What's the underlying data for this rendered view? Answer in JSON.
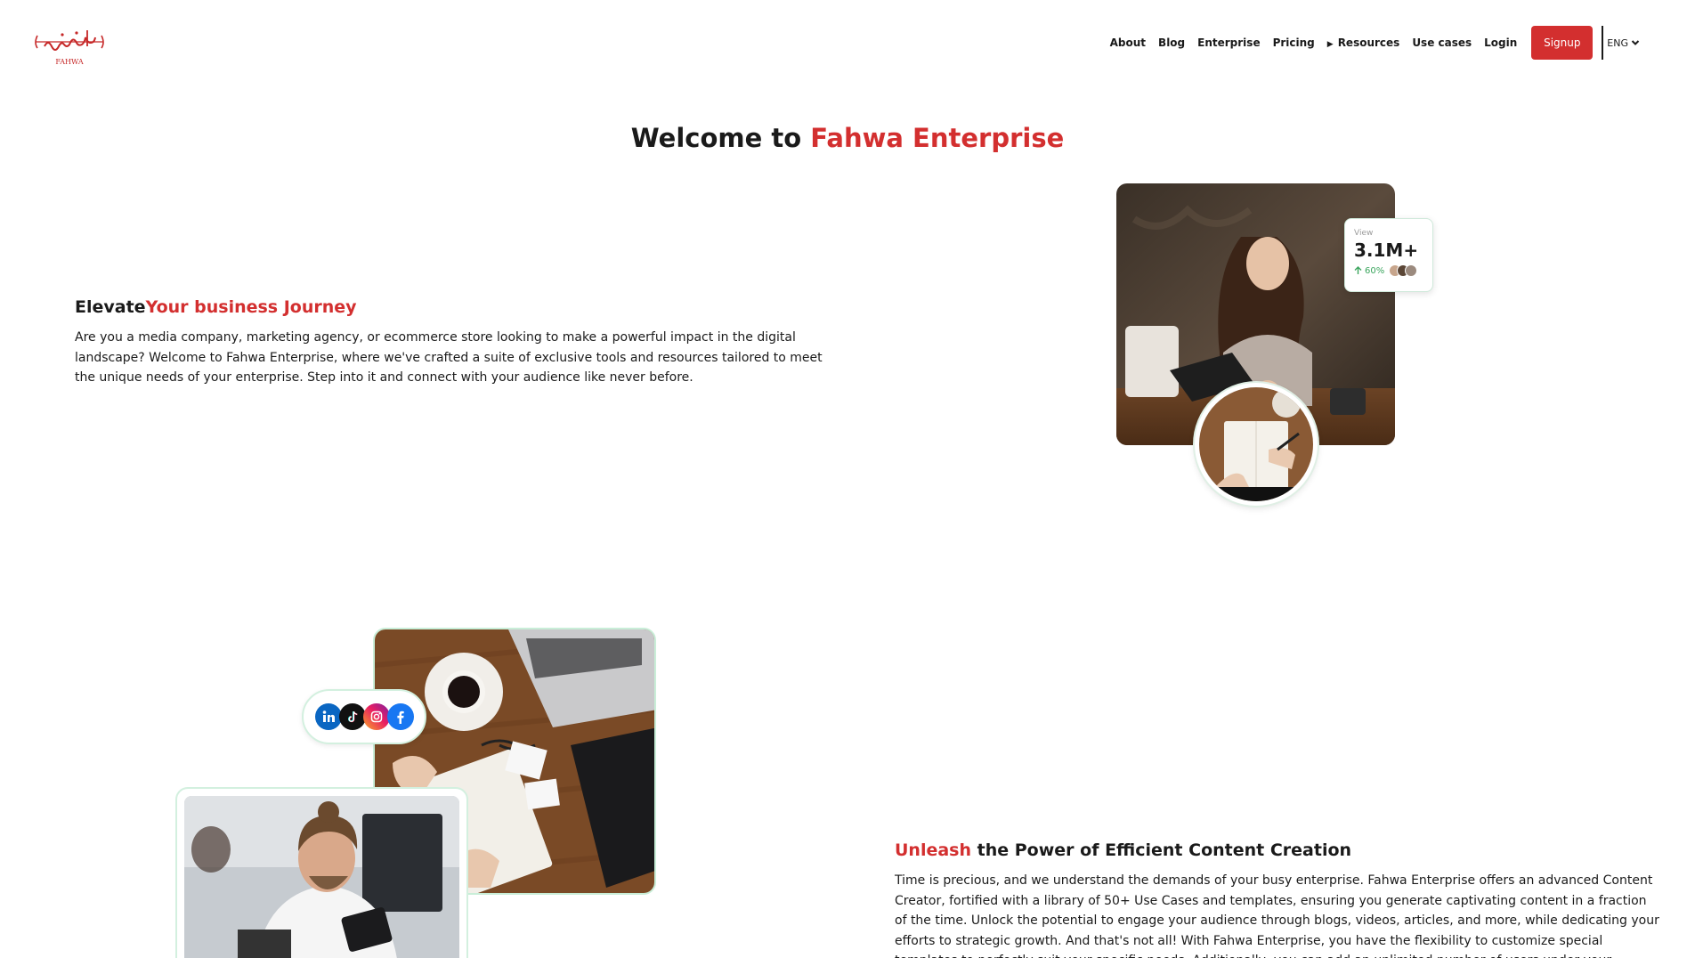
{
  "brand": {
    "logo_script": "فحوى",
    "logo_text": "FAHWA",
    "accent": "#d32f2f"
  },
  "nav": {
    "about": "About",
    "blog": "Blog",
    "enterprise": "Enterprise",
    "pricing": "Pricing",
    "resources": "Resources",
    "use_cases": "Use cases",
    "login": "Login",
    "signup": "Signup",
    "language": "ENG"
  },
  "hero": {
    "welcome_prefix": "Welcome to ",
    "welcome_brand": "Fahwa Enterprise"
  },
  "section1": {
    "title_plain": "Elevate",
    "title_accent": "Your business Journey",
    "body": "Are you a media company, marketing agency, or ecommerce store looking to make a powerful impact in the digital landscape? Welcome to Fahwa Enterprise, where we've crafted a suite of exclusive tools and resources tailored to meet the unique needs of your enterprise. Step into it and connect with your audience like never before.",
    "stat": {
      "label": "View",
      "value": "3.1M+",
      "change": "60%"
    }
  },
  "section2": {
    "title_accent": "Unleash",
    "title_plain": " the Power of Efficient Content Creation",
    "body": "Time is precious, and we understand the demands of your busy enterprise. Fahwa Enterprise offers an advanced Content Creator, fortified with a library of 50+ Use Cases and templates, ensuring you generate captivating content in a fraction of the time. Unlock the potential to engage your audience through blogs, videos, articles, and more, while dedicating your efforts to strategic growth. And that's not all! With Fahwa Enterprise, you have the flexibility to customize special templates to perfectly suit your specific needs. Additionally, you can add an unlimited number of users under your enterprise account, allowing",
    "social_icons": [
      "linkedin-icon",
      "tiktok-icon",
      "instagram-icon",
      "facebook-icon"
    ]
  }
}
